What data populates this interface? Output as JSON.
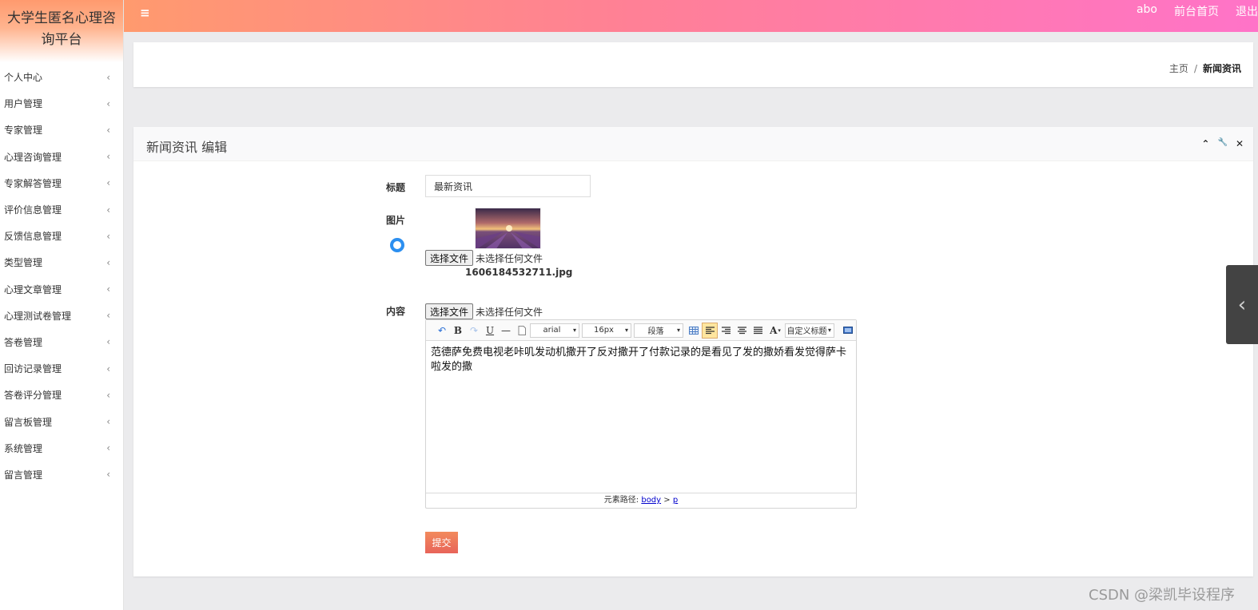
{
  "brand": {
    "title": "大学生匿名心理咨询平台"
  },
  "sidebar": {
    "items": [
      {
        "label": "个人中心"
      },
      {
        "label": "用户管理"
      },
      {
        "label": "专家管理"
      },
      {
        "label": "心理咨询管理"
      },
      {
        "label": "专家解答管理"
      },
      {
        "label": "评价信息管理"
      },
      {
        "label": "反馈信息管理"
      },
      {
        "label": "类型管理"
      },
      {
        "label": "心理文章管理"
      },
      {
        "label": "心理测试卷管理"
      },
      {
        "label": "答卷管理"
      },
      {
        "label": "回访记录管理"
      },
      {
        "label": "答卷评分管理"
      },
      {
        "label": "留言板管理"
      },
      {
        "label": "系统管理"
      },
      {
        "label": "留言管理"
      }
    ],
    "chevron": "‹"
  },
  "topbar": {
    "menu_icon": "≡",
    "user": "abo",
    "home_link": "前台首页",
    "logout": "退出"
  },
  "breadcrumb": {
    "home": "主页",
    "separator": "/",
    "current": "新闻资讯"
  },
  "panel": {
    "title": "新闻资讯 编辑",
    "tools": {
      "collapse": "⌃",
      "settings": "🔧",
      "close": "✕"
    }
  },
  "form": {
    "title_label": "标题",
    "title_value": "最新资讯",
    "image_label": "图片",
    "file_button": "选择文件",
    "file_none": "未选择任何文件",
    "image_filename": "1606184532711.jpg",
    "content_label": "内容",
    "content_file_button": "选择文件",
    "content_file_none": "未选择任何文件",
    "submit": "提交"
  },
  "editor": {
    "font": "arial",
    "size": "16px",
    "paragraph": "段落",
    "custom_title": "自定义标题",
    "content": "范德萨免费电视老咔叽发动机撒开了反对撒开了付款记录的是看见了发的撒娇看发觉得萨卡啦发的撒",
    "path_label": "元素路径:",
    "path_body": "body",
    "path_sep": ">",
    "path_p": "p"
  },
  "side_tab": {
    "icon": "‹"
  },
  "watermark": "CSDN @梁凯毕设程序"
}
